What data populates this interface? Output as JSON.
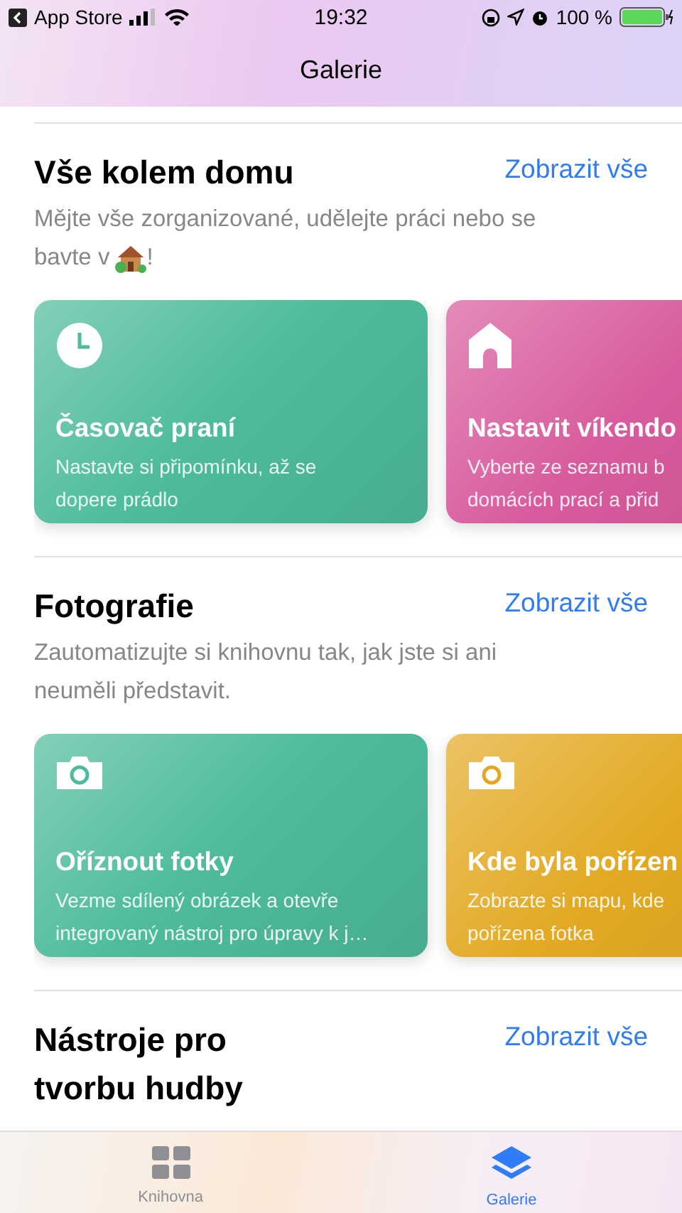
{
  "status_bar": {
    "back_label": "App Store",
    "time": "19:32",
    "battery": "100 %"
  },
  "nav": {
    "title": "Galerie"
  },
  "sections": [
    {
      "title": "Vše kolem domu",
      "link": "Zobrazit vše",
      "description": [
        [
          "Mějte vše zorganizované, udělejte práci nebo se",
          "bavte v"
        ],
        [
          "!"
        ]
      ],
      "cards": [
        {
          "kind": "clock",
          "color": "#4dbb9c",
          "title": "Časovač praní",
          "text": [
            "Nastavte si připomínku, až se",
            "dopere prádlo"
          ]
        },
        {
          "kind": "house",
          "color": "#d85a9c",
          "title": "Nastavit víkendo",
          "text": [
            "Vyberte ze seznamu b",
            "domácích prací a přid"
          ]
        }
      ]
    },
    {
      "title": "Fotografie",
      "link": "Zobrazit vše",
      "description": [
        [
          "Zautomatizujte si knihovnu tak, jak jste si ani",
          "neuměli představit."
        ]
      ],
      "cards": [
        {
          "kind": "camera",
          "color": "#4dbb9c",
          "title": "Oříznout fotky",
          "text": [
            "Vezme sdílený obrázek a otevře",
            "integrovaný nástroj pro úpravy k j…"
          ]
        },
        {
          "kind": "camera",
          "color": "#e3a922",
          "title": "Kde byla pořízen",
          "text": [
            "Zobrazte si mapu, kde",
            "pořízena fotka"
          ]
        }
      ]
    },
    {
      "title": "Nástroje pro tvorbu hudby",
      "link": "Zobrazit vše"
    }
  ],
  "tabs": [
    {
      "label": "Knihovna",
      "selected": false
    },
    {
      "label": "Galerie",
      "selected": true
    }
  ]
}
